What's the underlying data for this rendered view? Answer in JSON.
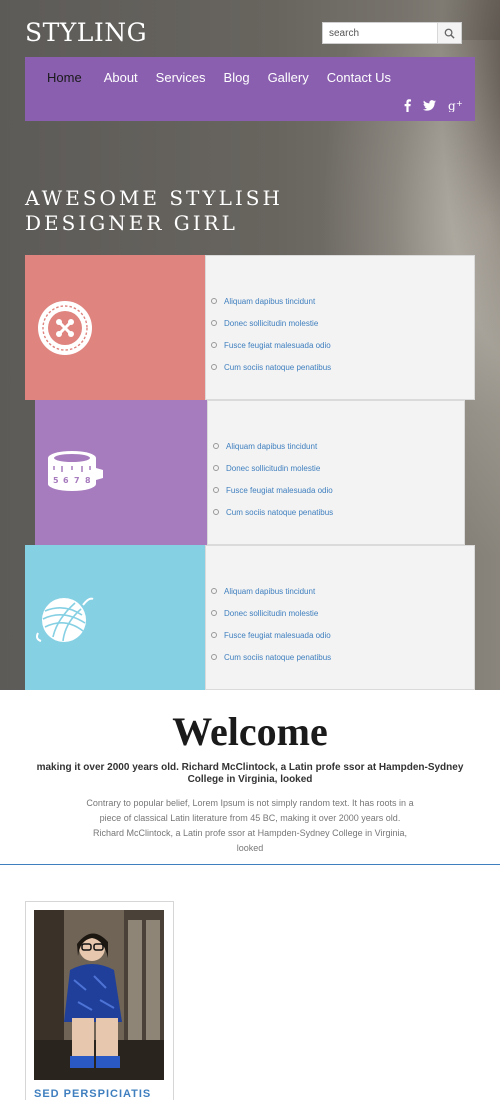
{
  "header": {
    "logo": "STYLING",
    "search": {
      "placeholder": "search"
    }
  },
  "nav": {
    "items": [
      {
        "label": "Home",
        "active": true
      },
      {
        "label": "About",
        "active": false
      },
      {
        "label": "Services",
        "active": false
      },
      {
        "label": "Blog",
        "active": false
      },
      {
        "label": "Gallery",
        "active": false
      },
      {
        "label": "Contact Us",
        "active": false
      }
    ],
    "social": [
      "facebook-icon",
      "twitter-icon",
      "google-plus-icon"
    ]
  },
  "hero": {
    "title_line1": "Awesome Stylish",
    "title_line2": "Designer Girl"
  },
  "panels": [
    {
      "color": "#e0847f",
      "icon": "buttons-icon",
      "items": [
        "Aliquam dapibus tincidunt",
        "Donec sollicitudin molestie",
        "Fusce feugiat malesuada odio",
        "Cum sociis natoque penatibus"
      ]
    },
    {
      "color": "#a77cbe",
      "icon": "measuring-tape-icon",
      "items": [
        "Aliquam dapibus tincidunt",
        "Donec sollicitudin molestie",
        "Fusce feugiat malesuada odio",
        "Cum sociis natoque penatibus"
      ]
    },
    {
      "color": "#86d0e4",
      "icon": "yarn-ball-icon",
      "items": [
        "Aliquam dapibus tincidunt",
        "Donec sollicitudin molestie",
        "Fusce feugiat malesuada odio",
        "Cum sociis natoque penatibus"
      ]
    }
  ],
  "welcome": {
    "title": "Welcome",
    "lead": "making it over 2000 years old. Richard McClintock, a Latin profe ssor at Hampden-Sydney College in Virginia, looked",
    "body": "Contrary to popular belief, Lorem Ipsum is not simply random text. It has roots in a piece of classical Latin literature from 45 BC, making it over 2000 years old. Richard McClintock, a Latin profe ssor at Hampden-Sydney College in Virginia, looked"
  },
  "card": {
    "title": "Sed Perspiciatis"
  },
  "colors": {
    "accent": "#8a5fb0",
    "link": "#3f7fbf",
    "coral": "#e0847f",
    "purple": "#a77cbe",
    "sky": "#86d0e4"
  }
}
